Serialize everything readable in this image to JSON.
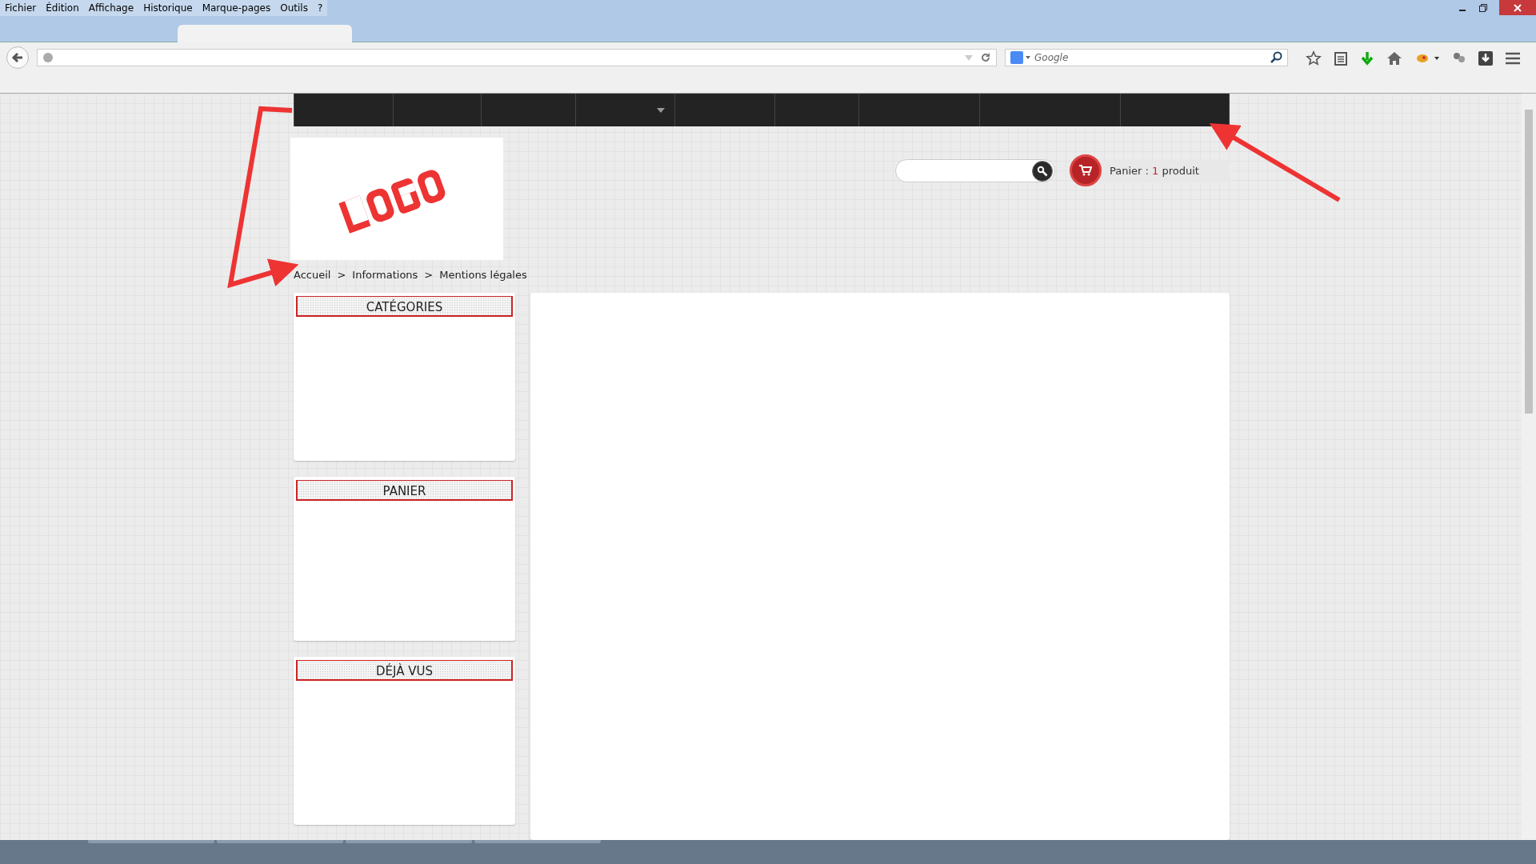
{
  "menu_bar": [
    "Fichier",
    "Édition",
    "Affichage",
    "Historique",
    "Marque-pages",
    "Outils",
    "?"
  ],
  "browser_search": {
    "placeholder": "Google"
  },
  "site_nav": [
    {
      "dropdown": false
    },
    {
      "dropdown": false
    },
    {
      "dropdown": false
    },
    {
      "dropdown": true
    },
    {
      "dropdown": false
    },
    {
      "dropdown": false
    },
    {
      "dropdown": false
    },
    {
      "dropdown": false
    },
    {
      "dropdown": false
    }
  ],
  "cart": {
    "label": "Panier :",
    "count": "1",
    "unit": "produit"
  },
  "breadcrumb": {
    "items": [
      "Accueil",
      "Informations",
      "Mentions légales"
    ],
    "separator": ">"
  },
  "sidebar": [
    {
      "title": "CATÉGORIES"
    },
    {
      "title": "PANIER"
    },
    {
      "title": "DÉJÀ VUS"
    }
  ]
}
